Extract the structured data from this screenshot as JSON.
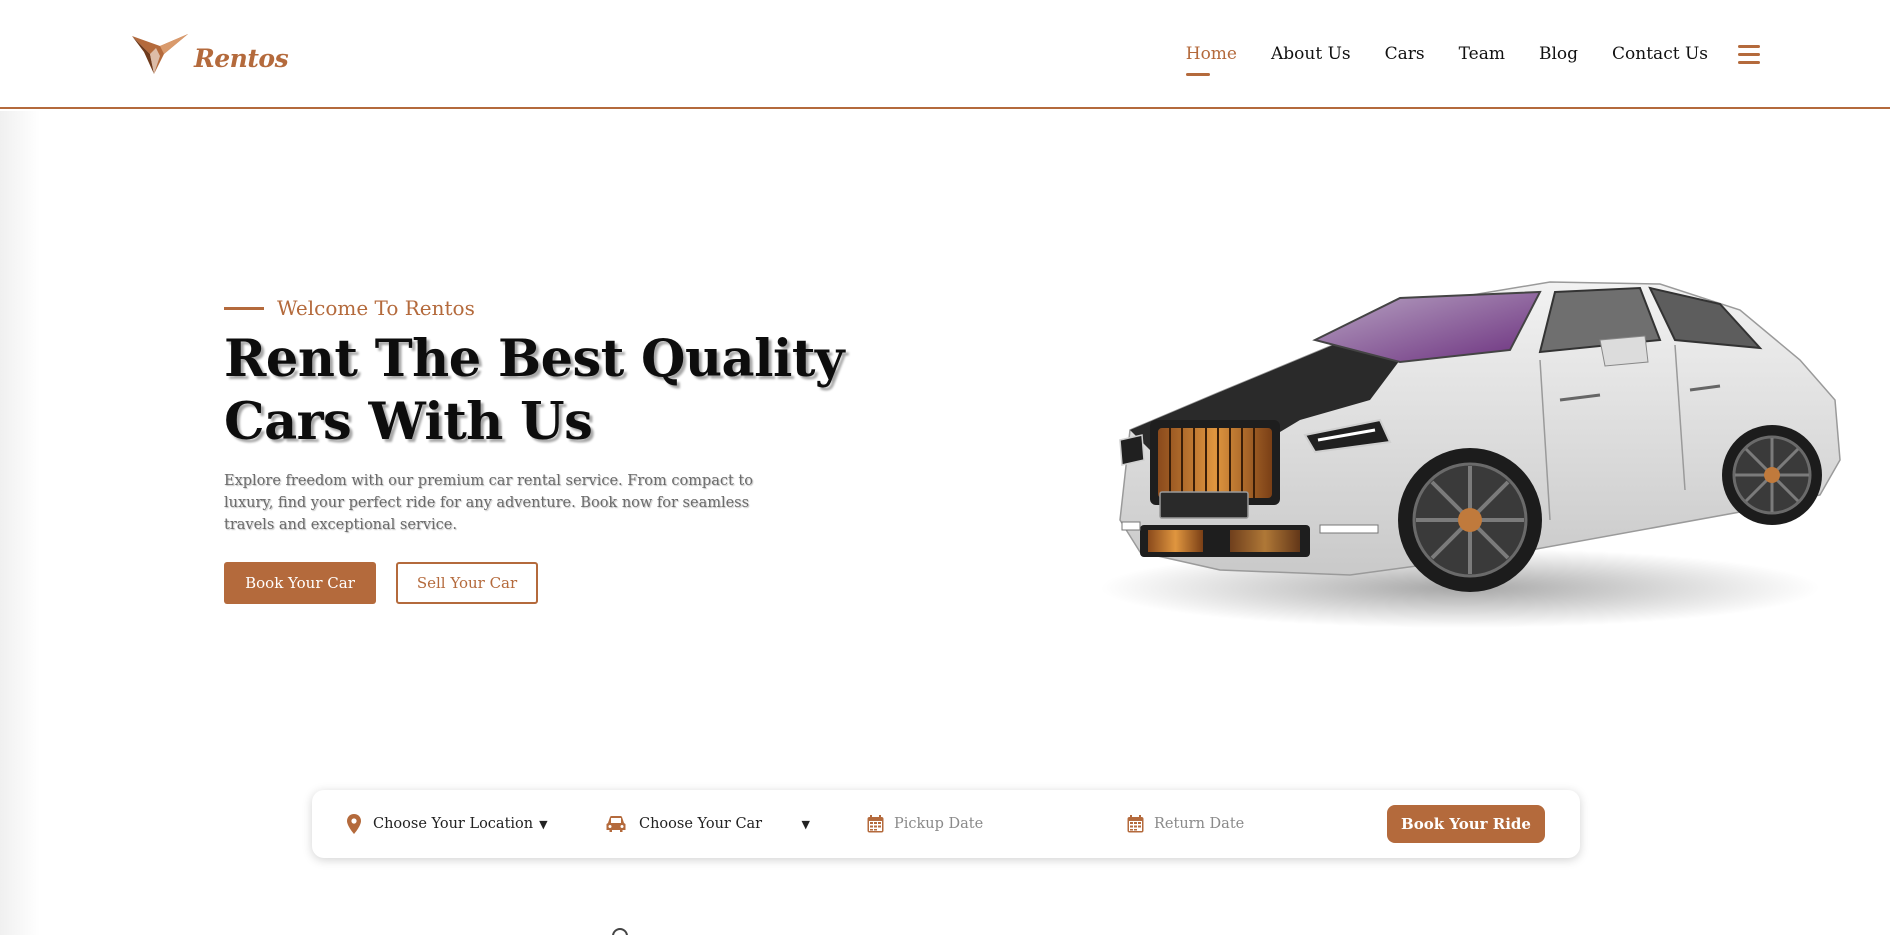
{
  "brand": {
    "name": "Rentos",
    "accent_color": "#b46a3c"
  },
  "nav": {
    "items": [
      {
        "label": "Home",
        "active": true
      },
      {
        "label": "About Us",
        "active": false
      },
      {
        "label": "Cars",
        "active": false
      },
      {
        "label": "Team",
        "active": false
      },
      {
        "label": "Blog",
        "active": false
      },
      {
        "label": "Contact Us",
        "active": false
      }
    ],
    "menu_icon": "hamburger-icon"
  },
  "hero": {
    "eyebrow": "Welcome To Rentos",
    "title_line1": "Rent The Best Quality",
    "title_line2": "Cars With Us",
    "description": "Explore freedom with our premium car rental service. From compact to luxury, find your perfect ride for any adventure. Book now for seamless travels and exceptional service.",
    "primary_button": "Book Your Car",
    "secondary_button": "Sell Your Car",
    "image": "luxury-car-image"
  },
  "booking": {
    "location": {
      "label": "Choose Your Location",
      "icon": "map-pin-icon"
    },
    "car": {
      "label": "Choose Your Car",
      "icon": "car-icon"
    },
    "pickup": {
      "placeholder": "Pickup Date",
      "icon": "calendar-icon"
    },
    "return": {
      "placeholder": "Return Date",
      "icon": "calendar-icon"
    },
    "submit": "Book Your Ride"
  }
}
